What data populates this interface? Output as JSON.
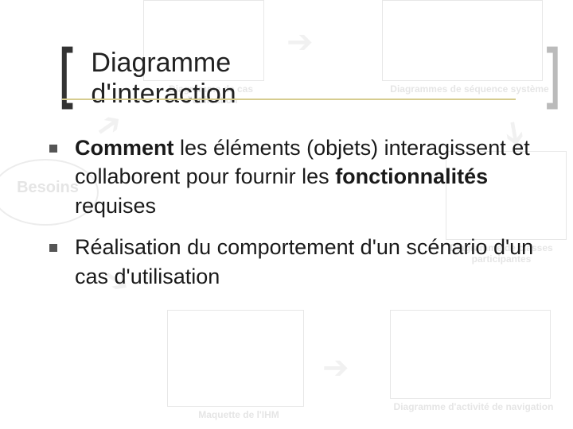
{
  "title": "Diagramme d'interaction",
  "bullets": [
    {
      "lead": "Comment",
      "mid1": " les éléments (objets) interagissent et collaborent pour fournir les ",
      "strong2": "fonctionnalités",
      "tail": " requises"
    },
    {
      "plain": "Réalisation du comportement d'un scénario d'un cas d'utilisation"
    }
  ],
  "bg": {
    "besoins": "Besoins",
    "usecase": "Diagramme de cas d'utilisation",
    "seq": "Diagrammes de séquence système",
    "classes": "Diagramme de classes participantes",
    "nav": "Diagramme d'activité de navigation",
    "ihm": "Maquette de l'IHM"
  }
}
